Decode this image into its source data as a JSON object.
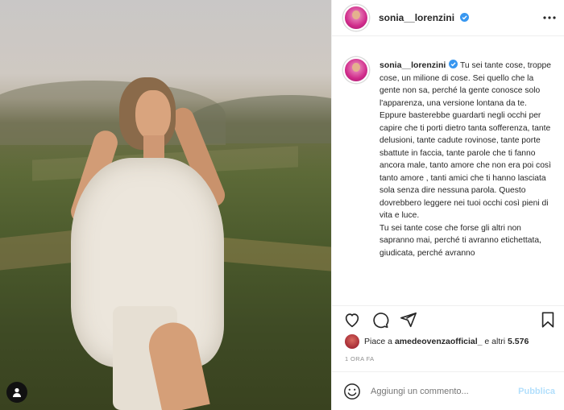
{
  "post": {
    "username": "sonia__lorenzini",
    "caption_paragraphs": [
      "Tu sei tante cose, troppe cose, un milione di cose. Sei quello che la gente non sa, perché la gente conosce solo l'apparenza, una versione lontana da te.",
      "Eppure basterebbe guardarti negli occhi per capire che ti porti dietro tanta sofferenza, tante delusioni, tante cadute rovinose, tante porte sbattute in faccia, tante parole che ti fanno ancora male, tanto amore che non era poi così tanto amore , tanti amici che ti hanno lasciata sola senza dire nessuna parola. Questo dovrebbero leggere nei tuoi occhi così pieni di vita e luce.",
      "Tu sei tante cose che forse gli altri non sapranno mai, perché ti avranno etichettata, giudicata, perché avranno"
    ]
  },
  "likes": {
    "prefix": "Piace a",
    "user": "amedeovenzaofficial_",
    "middle": "e altri",
    "count": "5.576"
  },
  "timestamp": "1 ORA FA",
  "comment": {
    "placeholder": "Aggiungi un commento...",
    "publish_label": "Pubblica"
  },
  "colors": {
    "verified": "#3897f0",
    "publish_disabled": "#b2dffc",
    "muted_text": "#8e8e8e"
  },
  "icons": [
    "verified-icon",
    "more-options-icon",
    "heart-icon",
    "comment-icon",
    "share-icon",
    "bookmark-icon",
    "emoji-icon",
    "user-tag-icon"
  ]
}
